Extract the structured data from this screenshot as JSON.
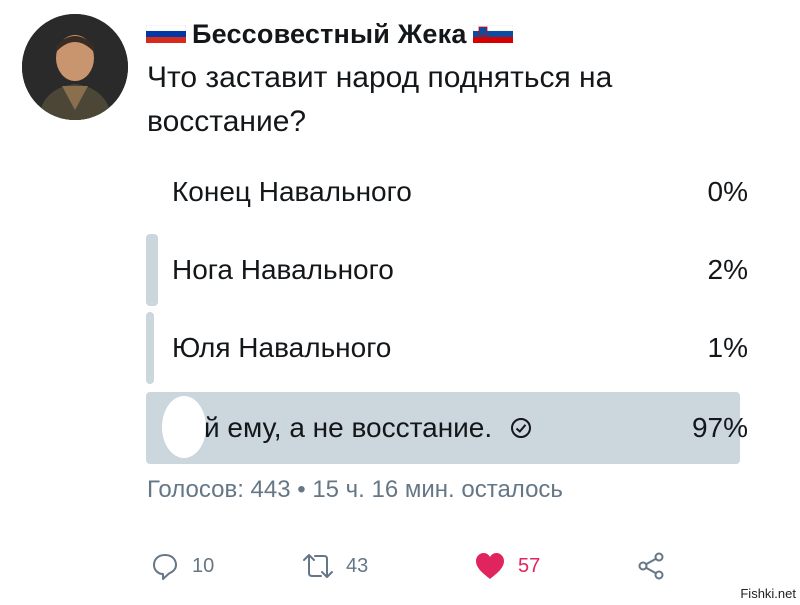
{
  "tweet": {
    "author_name": "Бессовестный Жека",
    "question": "Что заставит народ подняться на восстание?"
  },
  "poll": {
    "options": [
      {
        "label": "Конец Навального",
        "percent": "0%",
        "fraction": 0.0
      },
      {
        "label": "Нога Навального",
        "percent": "2%",
        "fraction": 0.02
      },
      {
        "label": "Юля Навального",
        "percent": "1%",
        "fraction": 0.01
      },
      {
        "label": "й ему, а не восстание.",
        "percent": "97%",
        "fraction": 0.97,
        "selected": true
      }
    ],
    "meta": "Голосов: 443 • 15 ч. 16 мин. осталось"
  },
  "actions": {
    "reply_count": "10",
    "retweet_count": "43",
    "like_count": "57"
  },
  "colors": {
    "bar": "#ccd6dd",
    "like": "#e0245e",
    "meta": "#657786"
  },
  "watermark": "Fishki.net"
}
